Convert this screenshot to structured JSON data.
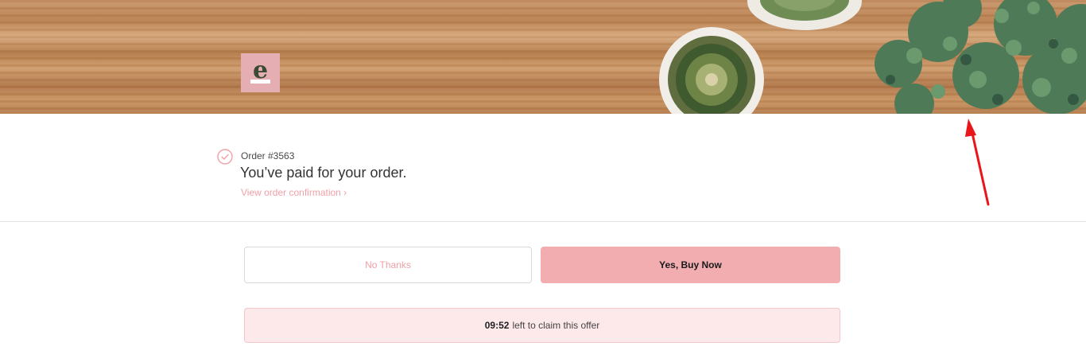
{
  "banner": {
    "logo_letter": "e",
    "logo_color": "#e4aeb2"
  },
  "status": {
    "icon": "check-circle-icon",
    "order_number": "Order #3563",
    "title": "You’ve paid for your order.",
    "view_link": "View order confirmation ›"
  },
  "offer": {
    "no_label": "No Thanks",
    "yes_label": "Yes, Buy Now",
    "timer_value": "09:52",
    "timer_text": "left to claim this offer"
  },
  "colors": {
    "accent_pink": "#f2adb1",
    "link_pink": "#f0a0a6",
    "timer_bg": "#fde8ea",
    "annotation_arrow": "#e8161b"
  }
}
